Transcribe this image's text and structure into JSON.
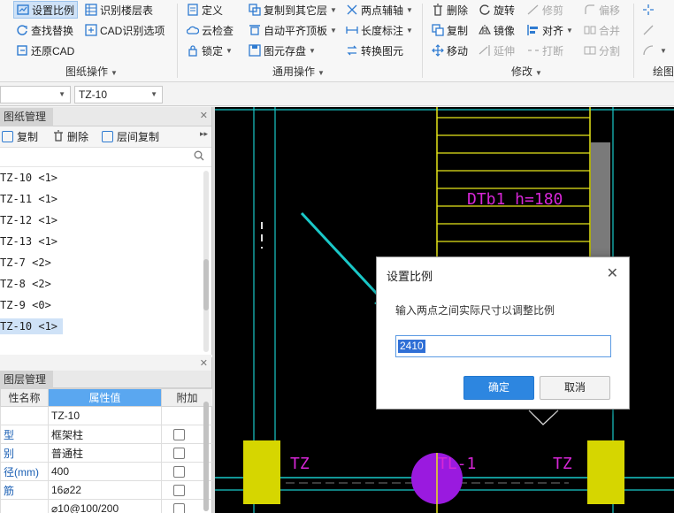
{
  "ribbon": {
    "drawing_ops": {
      "group_label": "图纸操作",
      "set_scale": "设置比例",
      "find_replace": "查找替换",
      "restore_cad": "还原CAD",
      "identify_floors": "识别楼层表",
      "cad_options": "CAD识别选项"
    },
    "general_ops": {
      "group_label": "通用操作",
      "define": "定义",
      "cloud_check": "云检查",
      "lock": "锁定",
      "copy_to_floor": "复制到其它层",
      "auto_align": "自动平齐顶板",
      "save_element": "图元存盘",
      "two_point_axis": "两点辅轴",
      "length_label": "长度标注",
      "convert_element": "转换图元"
    },
    "modify": {
      "group_label": "修改",
      "delete": "删除",
      "copy": "复制",
      "move": "移动",
      "rotate": "旋转",
      "mirror": "镜像",
      "extend": "延伸",
      "trim": "修剪",
      "align": "对齐",
      "break": "打断",
      "offset": "偏移",
      "merge": "合并",
      "split": "分割"
    },
    "draw": {
      "group_label": "绘图"
    }
  },
  "toolbar2": {
    "combo1_value": "",
    "combo2_value": "TZ-10"
  },
  "drawing_panel": {
    "tab_label": "图纸管理",
    "tools": {
      "copy": "复制",
      "delete": "删除",
      "floor_copy": "层间复制"
    },
    "items": [
      {
        "label": "TZ-10 <1>"
      },
      {
        "label": "TZ-11 <1>"
      },
      {
        "label": "TZ-12 <1>"
      },
      {
        "label": "TZ-13 <1>"
      },
      {
        "label": "TZ-7 <2>"
      },
      {
        "label": "TZ-8 <2>"
      },
      {
        "label": "TZ-9 <0>"
      },
      {
        "label": "TZ-10 <1>"
      }
    ],
    "selected_index": 7
  },
  "layer_panel": {
    "tab_label": "图层管理",
    "headers": {
      "name": "性名称",
      "value": "属性值",
      "extra": "附加"
    },
    "rows": [
      {
        "name": "",
        "value": "TZ-10",
        "has_checkbox": false
      },
      {
        "name": "型",
        "value": "框架柱",
        "has_checkbox": true
      },
      {
        "name": "别",
        "value": "普通柱",
        "has_checkbox": true
      },
      {
        "name": "径(mm)",
        "value": "400",
        "has_checkbox": true
      },
      {
        "name": "筋",
        "value": "16⌀22",
        "has_checkbox": true
      },
      {
        "name": "",
        "value": "⌀10@100/200",
        "has_checkbox": true
      }
    ]
  },
  "canvas": {
    "labels": {
      "stair": "DTb1  h=180",
      "tz_left": "TZ",
      "tl": "TL-1",
      "tz_right": "TZ"
    },
    "colors": {
      "background": "#000000",
      "cyan": "#19c9c9",
      "yellow": "#e6e619",
      "magenta": "#d626d6",
      "column_fill": "#d6d600",
      "circle": "#9a1adf"
    }
  },
  "dialog": {
    "title": "设置比例",
    "prompt": "输入两点之间实际尺寸以调整比例",
    "input_value": "2410",
    "ok": "确定",
    "cancel": "取消"
  }
}
